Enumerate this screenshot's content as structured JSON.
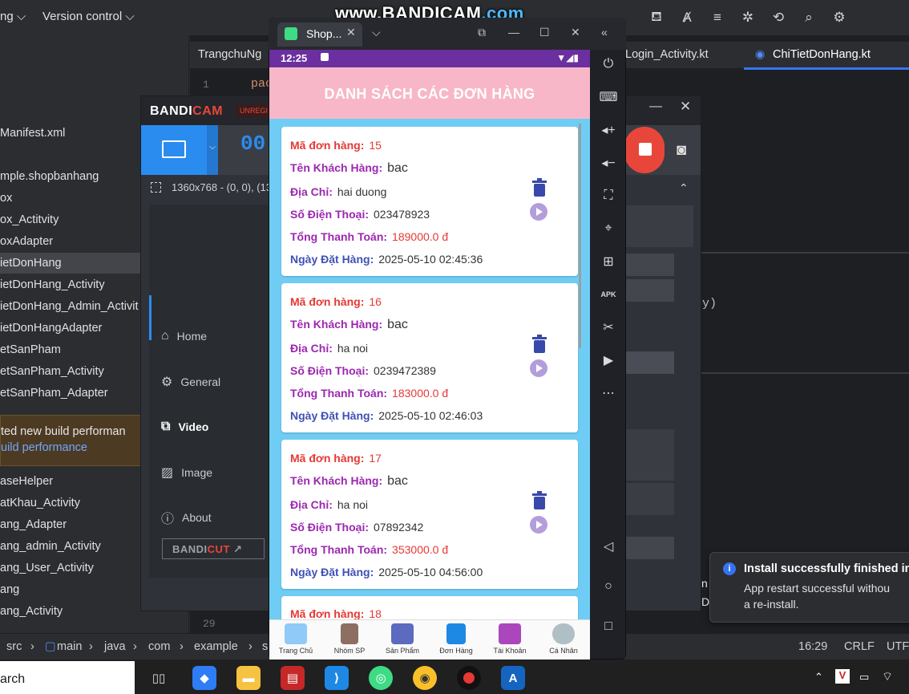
{
  "ide": {
    "menus": [
      "ng ⌵",
      "Version control ⌵"
    ],
    "project_items": [
      "Manifest.xml",
      "mple.shopbanhang",
      "ox",
      "ox_Actitvity",
      "oxAdapter",
      "ietDonHang",
      "ietDonHang_Activity",
      "ietDonHang_Admin_Activit",
      "ietDonHangAdapter",
      "etSanPham",
      "etSanPham_Activity",
      "etSanPham_Adapter",
      "aseHelper",
      "atKhau_Activity",
      "ang_Adapter",
      "ang_admin_Activity",
      "ang_User_Activity",
      "ang",
      "ang_Activity"
    ],
    "tabs": [
      "TrangchuNg",
      "Login_Activity.kt",
      "ChiTietDonHang.kt"
    ],
    "code_line_1_num": "1",
    "code_line_1": "pac",
    "code_line_29_num": "29",
    "code_fragment": "y)",
    "build_popup": {
      "line1": "ted new build performan",
      "line2": "uild performance"
    },
    "breadcrumbs": [
      "src",
      "main",
      "java",
      "com",
      "example",
      "s"
    ],
    "status_right": [
      "16:29",
      "CRLF",
      "UTF"
    ],
    "toast": {
      "title": "Install successfully finished in",
      "body1": "App restart successful withou",
      "body2": "a re-install.",
      "edge_char1": "n",
      "edge_char2": "D"
    }
  },
  "watermark": {
    "prefix": "www.",
    "name": "BANDICAM",
    "suffix": ".com"
  },
  "bandicam": {
    "logo_a": "BANDI",
    "logo_b": "CAM",
    "unreg": "UNREGI",
    "timer": "00",
    "resolution": "1360x768 - (0, 0), (13",
    "nav": [
      "Home",
      "General",
      "Video",
      "Image",
      "About"
    ],
    "bandicut_a": "BANDI",
    "bandicut_b": "CUT"
  },
  "emulator": {
    "tab_label": "Shop...",
    "status_time": "12:25",
    "header_title": "DANH SÁCH CÁC ĐƠN HÀNG",
    "labels": {
      "order_id": "Mã đơn hàng:",
      "customer": "Tên Khách Hàng:",
      "address": "Địa Chỉ:",
      "phone": "Số Điện Thoại:",
      "total": "Tổng Thanh Toán:",
      "date": "Ngày Đặt Hàng:"
    },
    "orders": [
      {
        "id": "15",
        "customer": "bac",
        "address": "hai duong",
        "phone": "023478923",
        "total": "189000.0  đ",
        "date": "2025-05-10 02:45:36"
      },
      {
        "id": "16",
        "customer": "bac",
        "address": "ha noi",
        "phone": "0239472389",
        "total": "183000.0  đ",
        "date": "2025-05-10 02:46:03"
      },
      {
        "id": "17",
        "customer": "bac",
        "address": "ha noi",
        "phone": "07892342",
        "total": "353000.0  đ",
        "date": "2025-05-10 04:56:00"
      },
      {
        "id": "18"
      }
    ],
    "bottom_nav": [
      "Trang Chủ",
      "Nhóm SP",
      "Sản Phẩm",
      "Đơn Hàng",
      "Tài Khoản",
      "Cá Nhân"
    ]
  },
  "taskbar": {
    "search": "arch"
  },
  "colors": {
    "accent_blue": "#2b8cf0",
    "record_red": "#e8463a",
    "header_pink": "#f7b7c8",
    "list_bg": "#6fcdf5"
  }
}
